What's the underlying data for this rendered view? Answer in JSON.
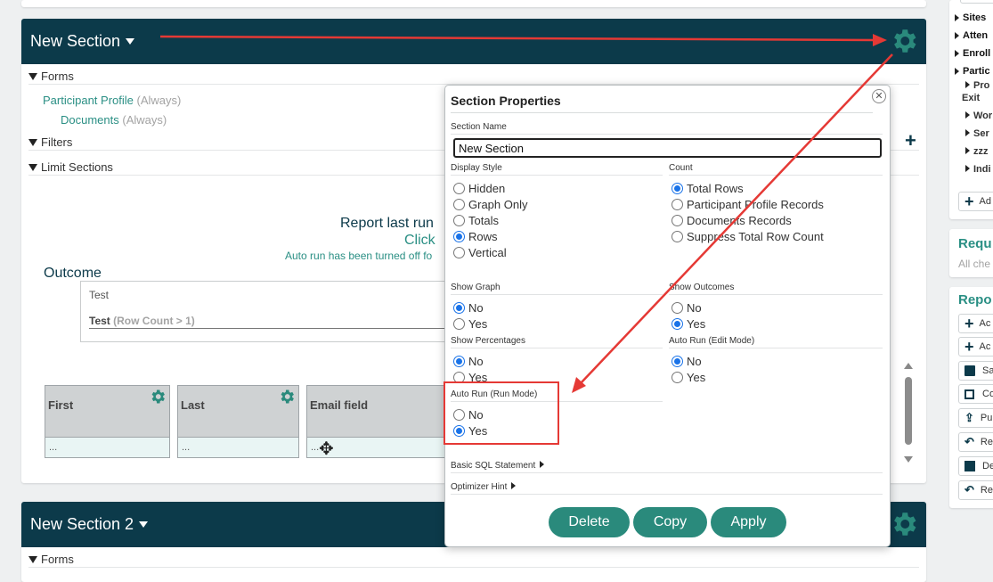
{
  "section1": {
    "title": "New Section",
    "forms_label": "Forms",
    "forms": [
      {
        "name": "Participant Profile",
        "tag": "(Always)"
      },
      {
        "name": "Documents",
        "tag": "(Always)"
      }
    ],
    "filters_label": "Filters",
    "limit_label": "Limit Sections",
    "report_last_run": "Report last run",
    "click_text": "Click",
    "auto_run_note": "Auto run has been turned off fo",
    "outcome_label": "Outcome",
    "outcome_test": "Test",
    "outcome_rule_name": "Test",
    "outcome_rule_cond": "(Row Count > 1)",
    "columns": [
      {
        "name": "First",
        "value": "..."
      },
      {
        "name": "Last",
        "value": "..."
      },
      {
        "name": "Email field",
        "value": "..."
      }
    ]
  },
  "section2": {
    "title": "New Section 2",
    "forms_label": "Forms"
  },
  "dialog": {
    "title": "Section Properties",
    "section_name_label": "Section Name",
    "section_name_value": "New Section",
    "display_style_label": "Display Style",
    "display_style_options": [
      "Hidden",
      "Graph Only",
      "Totals",
      "Rows",
      "Vertical"
    ],
    "count_label": "Count",
    "count_options": [
      "Total Rows",
      "Participant Profile Records",
      "Documents Records",
      "Suppress Total Row Count"
    ],
    "show_graph_label": "Show Graph",
    "show_outcomes_label": "Show Outcomes",
    "show_percentages_label": "Show Percentages",
    "auto_run_edit_label": "Auto Run (Edit Mode)",
    "auto_run_run_label": "Auto Run (Run Mode)",
    "no_label": "No",
    "yes_label": "Yes",
    "basic_sql_label": "Basic SQL Statement",
    "optimizer_label": "Optimizer Hint",
    "delete_label": "Delete",
    "copy_label": "Copy",
    "apply_label": "Apply"
  },
  "right_panel": {
    "tree": [
      "Sites",
      "Atten",
      "Enroll",
      "Partic"
    ],
    "subtree": [
      "Pro",
      "Exit",
      "Wor",
      "Ser",
      "zzz",
      "Indi"
    ],
    "add_label": "Ad",
    "requ_title": "Requ",
    "requ_note": "All che",
    "repo_title": "Repo",
    "repo_buttons": [
      "Ac",
      "Ac",
      "Sa",
      "Co",
      "Pu",
      "Re",
      "De",
      "Re"
    ]
  },
  "colors": {
    "header": "#0c3a4a",
    "teal": "#2a8f84",
    "annotation": "#e53935",
    "radio_on": "#1a73e8"
  }
}
